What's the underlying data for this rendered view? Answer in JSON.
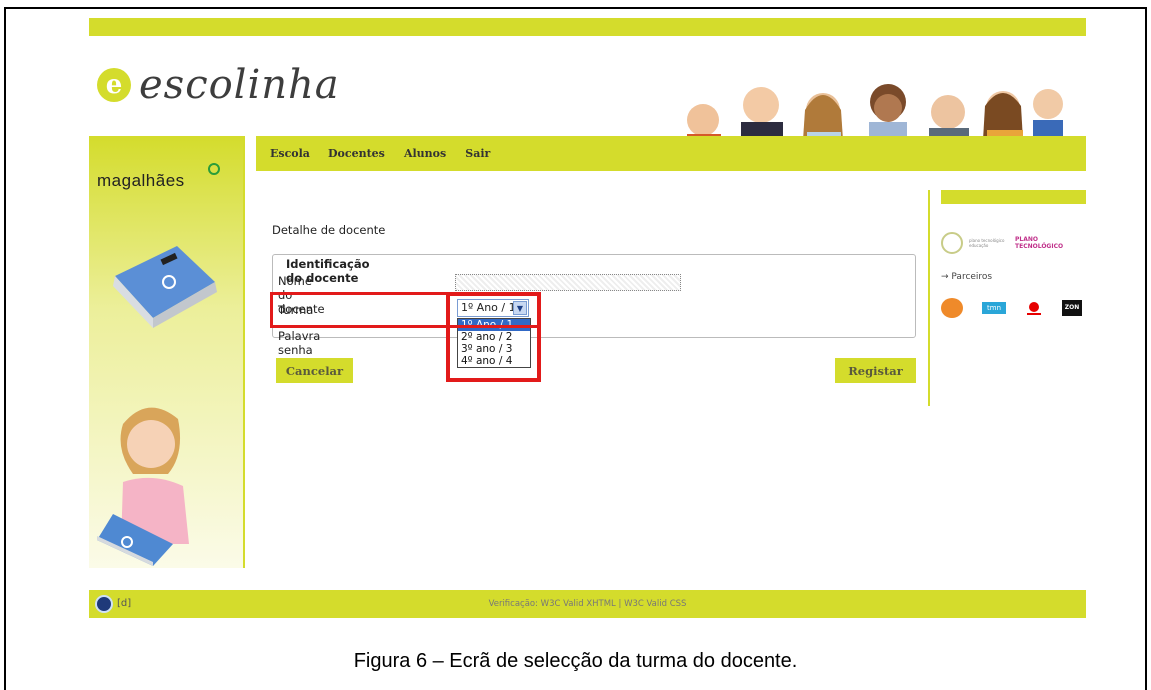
{
  "brand": {
    "logo_letter": "e",
    "logo_text": "escolinha",
    "sidebar_brand": "magalhães"
  },
  "nav": {
    "items": [
      "Escola",
      "Docentes",
      "Alunos",
      "Sair"
    ]
  },
  "page": {
    "title": "Detalhe de docente"
  },
  "form": {
    "legend": "Identificação do docente",
    "name_label": "Nome do docente",
    "turma_label": "Turma",
    "password_label": "Palavra senha",
    "turma_selected": "1º Ano / 1",
    "turma_options": [
      "1º Ano / 1",
      "2º ano / 2",
      "3º ano / 3",
      "4º ano / 4"
    ],
    "cancel_label": "Cancelar",
    "register_label": "Registar"
  },
  "right_panel": {
    "logo1_text": "plano tecnológico educação",
    "logo2_text": "PLANO TECNOLÓGICO",
    "parceiros_label": "→ Parceiros",
    "partners": [
      "sapo",
      "tmn",
      "vodafone",
      "ZON"
    ]
  },
  "footer": {
    "badge": "[d]",
    "text": "Verificação: W3C Valid XHTML | W3C Valid CSS"
  },
  "caption": "Figura 6 – Ecrã de selecção da turma do docente.",
  "colors": {
    "accent": "#d4dc2c",
    "highlight": "#e21a1a",
    "selection": "#3169c6"
  }
}
